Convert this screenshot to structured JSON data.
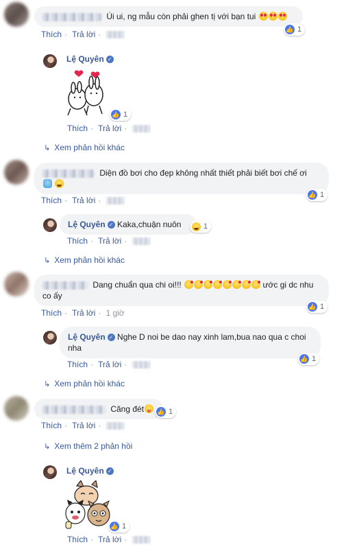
{
  "labels": {
    "like": "Thích",
    "reply": "Trả lời",
    "dot": "·"
  },
  "comments": [
    {
      "text": "Úi ui, ng mẫu còn phải ghen tị với bạn tui",
      "reactions": "1"
    },
    {
      "text": "Diện đồ bơi cho đẹp không nhất thiết phải biết bơi chế ơi",
      "reactions": "1"
    },
    {
      "text": "Dang chuẩn qua chi oi!!!",
      "text_after": "ước gi dc nhu co ấy",
      "time": "1 giờ",
      "reactions": "1"
    },
    {
      "text": "Căng đét",
      "reactions": "1"
    }
  ],
  "replies": [
    {
      "author": "Lệ Quyên",
      "verified_glyph": "✓",
      "reactions": "1"
    },
    {
      "author": "Lệ Quyên",
      "text": "Kaka,chuận nuôn",
      "reactions": "1"
    },
    {
      "author": "Lệ Quyên",
      "text": "Nghe D noi be dao nay xinh lam,bua nao qua c choi nha",
      "reactions": "1"
    },
    {
      "author": "Lệ Quyên",
      "reactions": "1"
    }
  ],
  "more_links": [
    "Xem phản hồi khác",
    "Xem phản hồi khác",
    "Xem phản hồi khác",
    "Xem thêm 2 phản hồi"
  ],
  "icons": {
    "like": "like-thumb-icon",
    "arrow": "reply-arrow-icon"
  },
  "colors": {
    "link": "#385898",
    "bubble": "#f2f3f5",
    "like_blue": "#4a76f0"
  }
}
